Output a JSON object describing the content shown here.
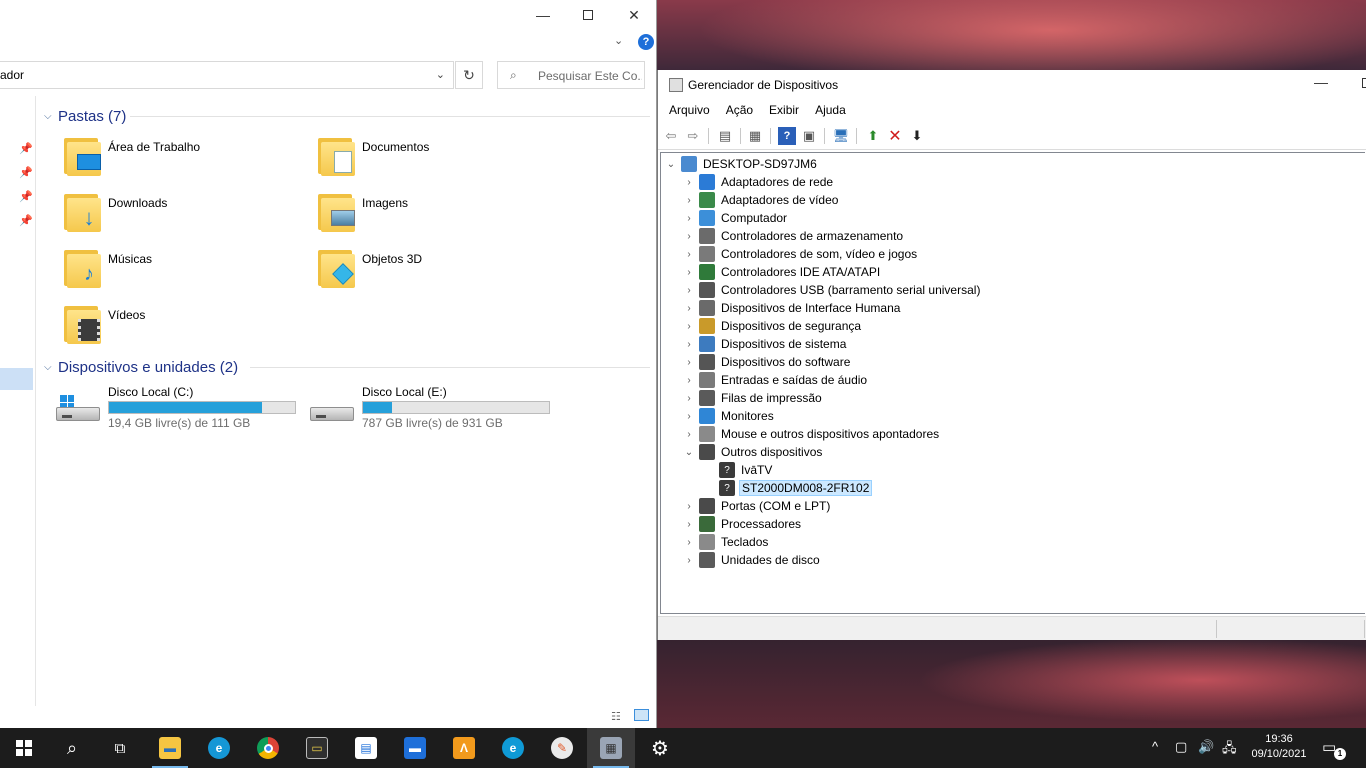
{
  "explorer": {
    "address_text": "ador",
    "search_placeholder": "Pesquisar Este Co...",
    "folders_group": "Pastas (7)",
    "folders": [
      {
        "label": "Área de Trabalho",
        "icon": "desktop-folder-icon"
      },
      {
        "label": "Documentos",
        "icon": "documents-folder-icon"
      },
      {
        "label": "Downloads",
        "icon": "downloads-folder-icon"
      },
      {
        "label": "Imagens",
        "icon": "pictures-folder-icon"
      },
      {
        "label": "Músicas",
        "icon": "music-folder-icon"
      },
      {
        "label": "Objetos 3D",
        "icon": "3d-objects-folder-icon"
      },
      {
        "label": "Vídeos",
        "icon": "videos-folder-icon"
      }
    ],
    "devices_group": "Dispositivos e unidades (2)",
    "drives": [
      {
        "label": "Disco Local (C:)",
        "free": "19,4 GB livre(s) de 111 GB",
        "used_fraction": 0.825
      },
      {
        "label": "Disco Local  (E:)",
        "free": "787 GB livre(s) de 931 GB",
        "used_fraction": 0.155
      }
    ]
  },
  "devmgr": {
    "title": "Gerenciador de Dispositivos",
    "menu": [
      "Arquivo",
      "Ação",
      "Exibir",
      "Ajuda"
    ],
    "root": "DESKTOP-SD97JM6",
    "items": [
      {
        "label": "Adaptadores de rede",
        "color": "#2b7bd6"
      },
      {
        "label": "Adaptadores de vídeo",
        "color": "#3a8a4a"
      },
      {
        "label": "Computador",
        "color": "#3c8fd9"
      },
      {
        "label": "Controladores de armazenamento",
        "color": "#6b6b6b"
      },
      {
        "label": "Controladores de som, vídeo e jogos",
        "color": "#7a7a7a"
      },
      {
        "label": "Controladores IDE ATA/ATAPI",
        "color": "#2f7a3a"
      },
      {
        "label": "Controladores USB (barramento serial universal)",
        "color": "#555555"
      },
      {
        "label": "Dispositivos de Interface Humana",
        "color": "#6a6a6a"
      },
      {
        "label": "Dispositivos de segurança",
        "color": "#c99a2a"
      },
      {
        "label": "Dispositivos de sistema",
        "color": "#3d7bbf"
      },
      {
        "label": "Dispositivos do software",
        "color": "#555555"
      },
      {
        "label": "Entradas e saídas de áudio",
        "color": "#7a7a7a"
      },
      {
        "label": "Filas de impressão",
        "color": "#5a5a5a"
      },
      {
        "label": "Monitores",
        "color": "#2f86d6"
      },
      {
        "label": "Mouse e outros dispositivos apontadores",
        "color": "#8a8a8a"
      },
      {
        "label": "Outros dispositivos",
        "color": "#4a4a4a"
      }
    ],
    "other_children": [
      "IvāTV",
      "ST2000DM008-2FR102"
    ],
    "items_after": [
      {
        "label": "Portas (COM e LPT)",
        "color": "#4a4a4a"
      },
      {
        "label": "Processadores",
        "color": "#3a6a3a"
      },
      {
        "label": "Teclados",
        "color": "#8a8a8a"
      },
      {
        "label": "Unidades de disco",
        "color": "#5a5a5a"
      }
    ]
  },
  "taskbar": {
    "time": "19:36",
    "date": "09/10/2021",
    "notification_count": "1"
  }
}
